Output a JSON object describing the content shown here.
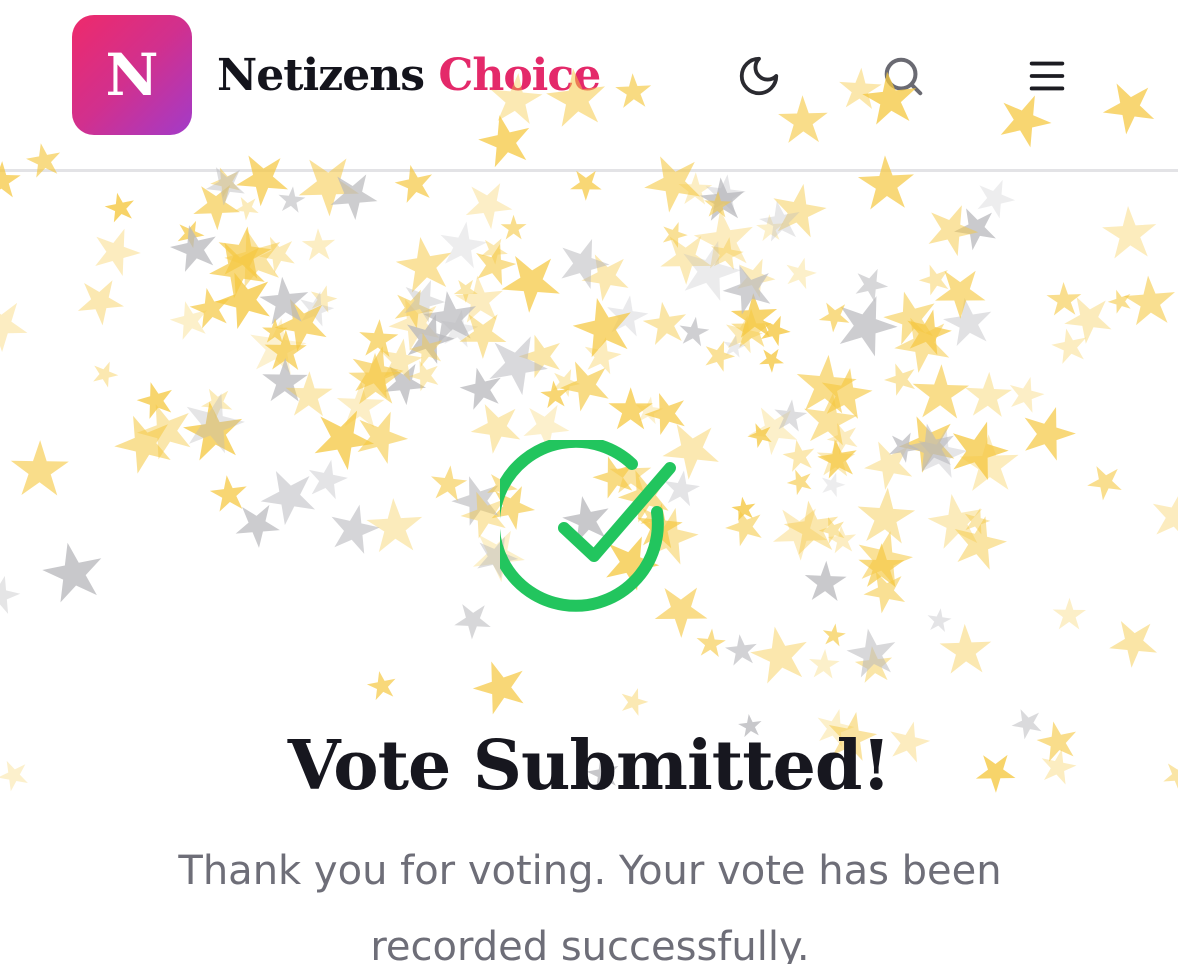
{
  "header": {
    "logo_letter": "N",
    "brand_main": "Netizens",
    "brand_accent": "Choice",
    "icons": [
      "moon-icon",
      "search-icon",
      "menu-icon"
    ]
  },
  "success": {
    "title": "Vote Submitted!",
    "message": "Thank you for voting. Your vote has been recorded successfully."
  },
  "colors": {
    "brand_accent": "#e4296a",
    "logo_gradient_start": "#ee2a6b",
    "logo_gradient_end": "#a23bc9",
    "success_green": "#22c55e",
    "star_gold": "#f5c842",
    "star_gray": "#b8b8bc"
  }
}
